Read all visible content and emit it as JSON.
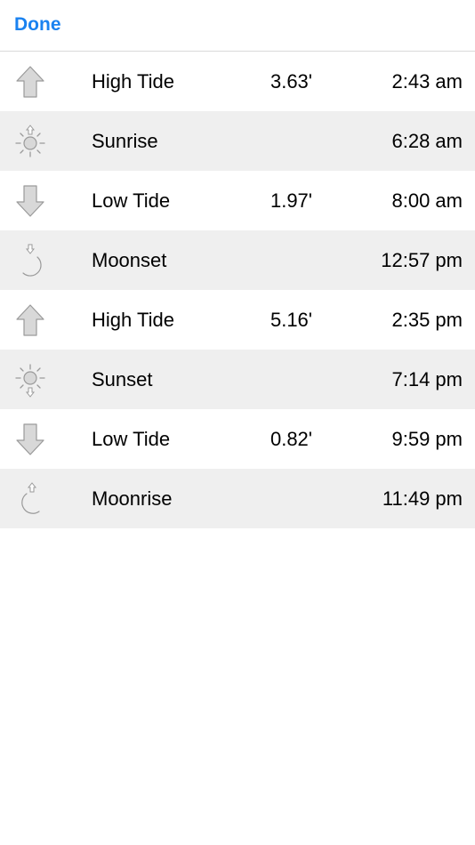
{
  "nav": {
    "done_label": "Done",
    "accent_color": "#1a82f0"
  },
  "events": [
    {
      "label": "High Tide",
      "height": "3.63'",
      "time": "2:43 am",
      "icon": "tide-up-arrow-icon"
    },
    {
      "label": "Sunrise",
      "height": "",
      "time": "6:28 am",
      "icon": "sunrise-icon"
    },
    {
      "label": "Low Tide",
      "height": "1.97'",
      "time": "8:00 am",
      "icon": "tide-down-arrow-icon"
    },
    {
      "label": "Moonset",
      "height": "",
      "time": "12:57 pm",
      "icon": "moonset-icon"
    },
    {
      "label": "High Tide",
      "height": "5.16'",
      "time": "2:35 pm",
      "icon": "tide-up-arrow-icon"
    },
    {
      "label": "Sunset",
      "height": "",
      "time": "7:14 pm",
      "icon": "sunset-icon"
    },
    {
      "label": "Low Tide",
      "height": "0.82'",
      "time": "9:59 pm",
      "icon": "tide-down-arrow-icon"
    },
    {
      "label": "Moonrise",
      "height": "",
      "time": "11:49 pm",
      "icon": "moonrise-icon"
    }
  ],
  "colors": {
    "row_shade": "#efefef",
    "icon_fill": "#d8d8d8",
    "icon_stroke": "#9a9a9a"
  }
}
